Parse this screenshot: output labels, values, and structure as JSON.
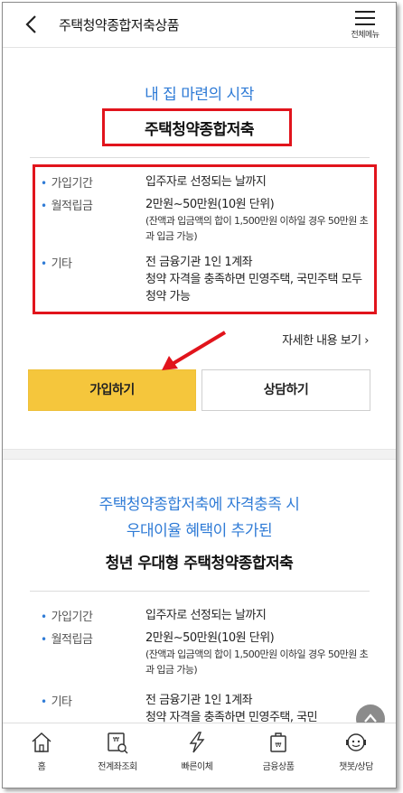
{
  "header": {
    "title": "주택청약종합저축상품",
    "menu_label": "전체메뉴"
  },
  "product1": {
    "tagline": "내 집 마련의 시작",
    "name": "주택청약종합저축",
    "info": [
      {
        "label": "가입기간",
        "value": "입주자로 선정되는 날까지"
      },
      {
        "label": "월적립금",
        "value": "2만원~50만원(10원 단위)",
        "note": "(잔액과 입금액의 합이 1,500만원 이하일 경우 50만원 초과 입금 가능)"
      },
      {
        "label": "기타",
        "value": "전 금융기관 1인 1계좌",
        "value2": "청약 자격을 충족하면 민영주택, 국민주택 모두 청약 가능"
      }
    ],
    "detail_link": "자세한 내용 보기",
    "join_button": "가입하기",
    "consult_button": "상담하기"
  },
  "product2": {
    "tagline_line1": "주택청약종합저축에 자격충족 시",
    "tagline_line2": "우대이율 혜택이 추가된",
    "name": "청년 우대형 주택청약종합저축",
    "info": [
      {
        "label": "가입기간",
        "value": "입주자로 선정되는 날까지"
      },
      {
        "label": "월적립금",
        "value": "2만원~50만원(10원 단위)",
        "note": "(잔액과 입금액의 합이 1,500만원 이하일 경우 50만원 초과 입금 가능)"
      },
      {
        "label": "기타",
        "value": "전 금융기관 1인 1계좌",
        "value2": "청약 자격을 충족하면 민영주택, 국민"
      }
    ]
  },
  "tabbar": {
    "items": [
      {
        "label": "홈",
        "icon": "home-icon"
      },
      {
        "label": "전계좌조회",
        "icon": "account-inquiry-icon"
      },
      {
        "label": "빠른이체",
        "icon": "quick-transfer-icon"
      },
      {
        "label": "금융상품",
        "icon": "financial-product-icon"
      },
      {
        "label": "챗봇/상담",
        "icon": "chatbot-icon"
      }
    ]
  },
  "colors": {
    "accent_blue": "#2f7bd6",
    "join_yellow": "#f5c63c",
    "highlight_red": "#e1141c"
  }
}
